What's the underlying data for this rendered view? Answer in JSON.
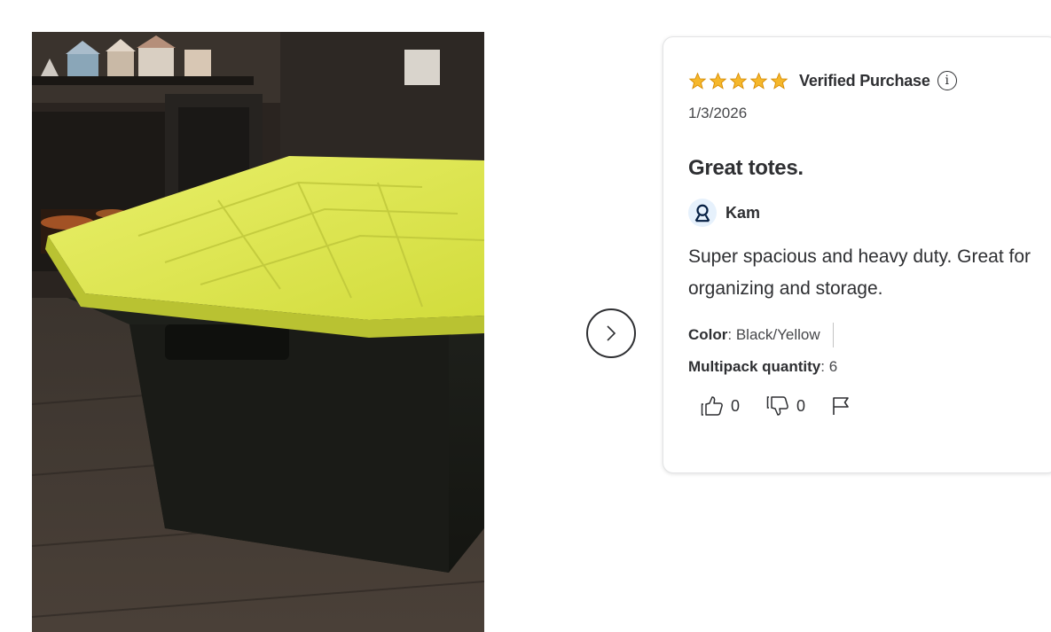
{
  "photo": {
    "alt_icon": "product-photo"
  },
  "navigation": {
    "next_icon": "chevron-right-icon"
  },
  "review": {
    "rating": 5,
    "rating_max": 5,
    "badge": "Verified Purchase",
    "info_glyph": "i",
    "date": "1/3/2026",
    "title": "Great totes.",
    "author": "Kam",
    "body": "Super spacious and heavy duty. Great for organizing and storage.",
    "attributes": [
      {
        "label": "Color",
        "separator": ": ",
        "value": "Black/Yellow"
      },
      {
        "label": "Multipack quantity",
        "separator": ": ",
        "value": "6"
      }
    ],
    "helpful_count": "0",
    "unhelpful_count": "0"
  },
  "colors": {
    "star": "#f5b72b",
    "star_outline": "#d68a00",
    "avatar_bg": "#e6f1fc",
    "avatar_icon": "#041e42",
    "text_primary": "#2e2f32"
  }
}
